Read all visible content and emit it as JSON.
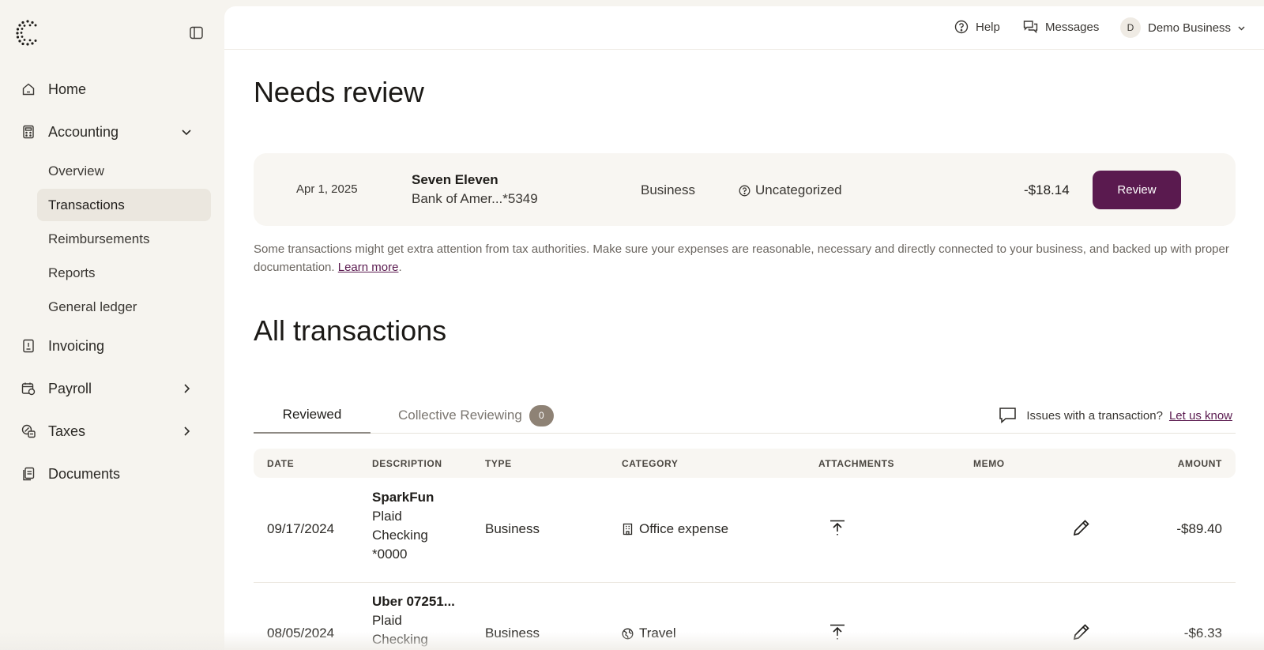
{
  "sidebar": {
    "items": [
      {
        "label": "Home",
        "icon": "home-icon"
      },
      {
        "label": "Accounting",
        "icon": "calculator-icon",
        "expanded": true
      },
      {
        "label": "Invoicing",
        "icon": "invoice-icon"
      },
      {
        "label": "Payroll",
        "icon": "payroll-icon"
      },
      {
        "label": "Taxes",
        "icon": "taxes-icon"
      },
      {
        "label": "Documents",
        "icon": "documents-icon"
      }
    ],
    "accounting_sub": [
      {
        "label": "Overview"
      },
      {
        "label": "Transactions",
        "active": true
      },
      {
        "label": "Reimbursements"
      },
      {
        "label": "Reports"
      },
      {
        "label": "General ledger"
      }
    ]
  },
  "topbar": {
    "help": "Help",
    "messages": "Messages",
    "avatar_initial": "D",
    "business": "Demo Business"
  },
  "needs_review": {
    "title": "Needs review",
    "card": {
      "date": "Apr 1, 2025",
      "name": "Seven Eleven",
      "account": "Bank of Amer...*5349",
      "type": "Business",
      "category": "Uncategorized",
      "amount": "-$18.14",
      "button": "Review"
    },
    "note": "Some transactions might get extra attention from tax authorities. Make sure your expenses are reasonable, necessary and directly connected to your business, and backed up with proper documentation.",
    "learn_more": "Learn more",
    "period": "."
  },
  "all_transactions": {
    "title": "All transactions",
    "tabs": [
      {
        "label": "Reviewed",
        "active": true
      },
      {
        "label": "Collective Reviewing",
        "badge": "0"
      }
    ],
    "issues_text": "Issues with a transaction?",
    "issues_link": "Let us know",
    "columns": [
      "DATE",
      "DESCRIPTION",
      "TYPE",
      "CATEGORY",
      "ATTACHMENTS",
      "MEMO",
      "AMOUNT"
    ],
    "rows": [
      {
        "date": "09/17/2024",
        "name": "SparkFun",
        "lines": [
          "Plaid",
          "Checking",
          "*0000"
        ],
        "type": "Business",
        "category": "Office expense",
        "category_icon": "building-icon",
        "amount": "-$89.40"
      },
      {
        "date": "08/05/2024",
        "name": "Uber 07251...",
        "lines": [
          "Plaid",
          "Checking"
        ],
        "type": "Business",
        "category": "Travel",
        "category_icon": "globe-icon",
        "amount": "-$6.33"
      }
    ]
  },
  "colors": {
    "accent": "#5a1a4f",
    "sidebar_bg": "#f6f4ef",
    "active_item_bg": "#ebe7df",
    "badge_bg": "#8e8275"
  }
}
